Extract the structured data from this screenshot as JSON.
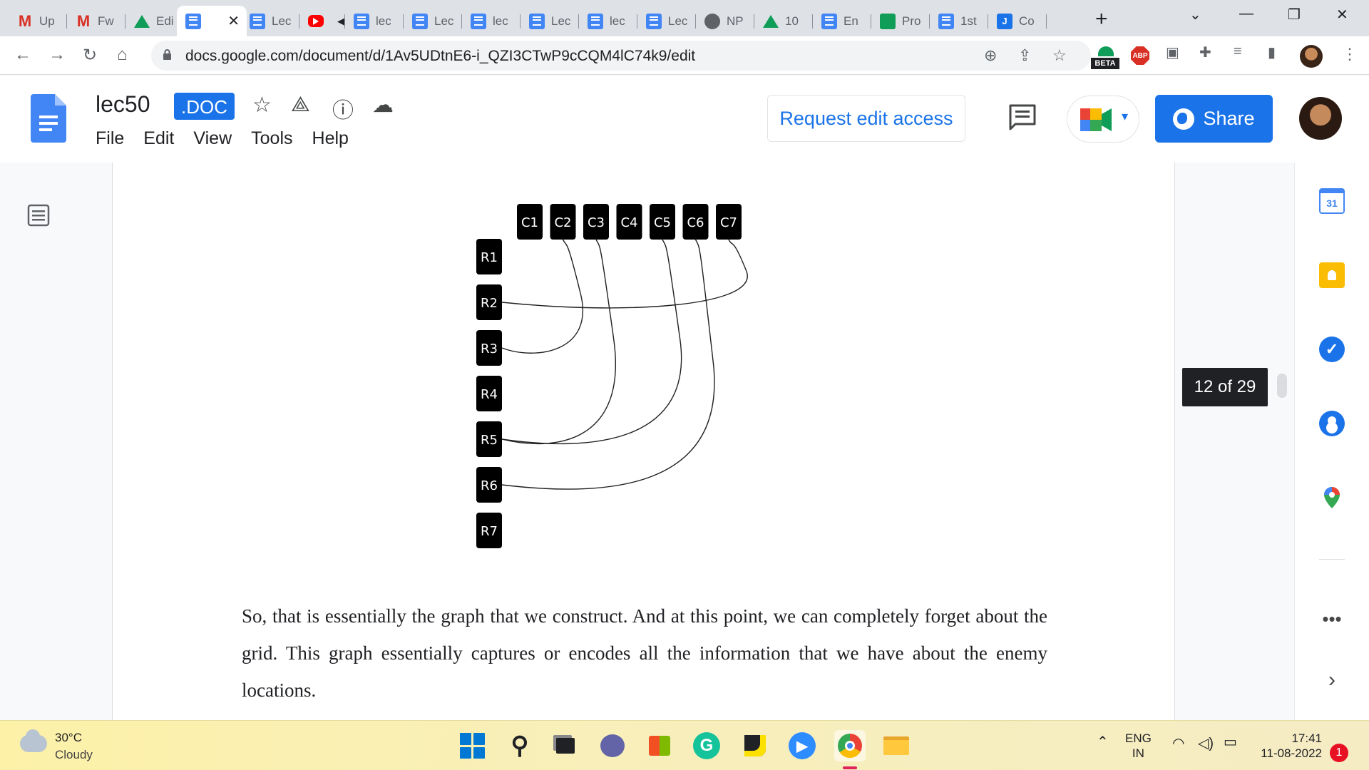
{
  "browser": {
    "tabs": [
      {
        "icon": "gmail",
        "label": "Up"
      },
      {
        "icon": "gmail",
        "label": "Fw"
      },
      {
        "icon": "drive",
        "label": "Edi"
      },
      {
        "icon": "docs",
        "label": "",
        "active": true
      },
      {
        "icon": "docs",
        "label": "Lec"
      },
      {
        "icon": "youtube",
        "label": ""
      },
      {
        "icon": "docs",
        "label": "lec"
      },
      {
        "icon": "docs",
        "label": "Lec"
      },
      {
        "icon": "docs",
        "label": "lec"
      },
      {
        "icon": "docs",
        "label": "Lec"
      },
      {
        "icon": "docs",
        "label": "lec"
      },
      {
        "icon": "docs",
        "label": "Lec"
      },
      {
        "icon": "globe",
        "label": "NP"
      },
      {
        "icon": "drive",
        "label": "10"
      },
      {
        "icon": "docs",
        "label": "En"
      },
      {
        "icon": "sheets",
        "label": "Pro"
      },
      {
        "icon": "docs",
        "label": "1st"
      },
      {
        "icon": "jamboard",
        "label": "Co"
      }
    ],
    "url": "docs.google.com/document/d/1Av5UDtnE6-i_QZI3CTwP9cCQM4lC74k9/edit",
    "extensions": {
      "beta_label": "BETA",
      "abp_label": "ABP"
    }
  },
  "docs": {
    "title": "lec50",
    "badge": ".DOC",
    "menu": [
      "File",
      "Edit",
      "View",
      "Tools",
      "Help"
    ],
    "request_access_label": "Request edit access",
    "share_label": "Share",
    "page_counter": "12 of 29"
  },
  "document": {
    "graph": {
      "columns": [
        "C1",
        "C2",
        "C3",
        "C4",
        "C5",
        "C6",
        "C7"
      ],
      "rows": [
        "R1",
        "R2",
        "R3",
        "R4",
        "R5",
        "R6",
        "R7"
      ],
      "edges": [
        [
          "R2",
          "C7"
        ],
        [
          "R3",
          "C2"
        ],
        [
          "R5",
          "C3"
        ],
        [
          "R5",
          "C5"
        ],
        [
          "R6",
          "C6"
        ]
      ]
    },
    "paragraph": "So, that is essentially the graph that we construct. And at this point, we can completely forget about the grid. This graph essentially captures or encodes all the information that we have about the enemy locations."
  },
  "side_panel": {
    "calendar_day": "31"
  },
  "taskbar": {
    "weather_temp": "30°C",
    "weather_desc": "Cloudy",
    "lang_top": "ENG",
    "lang_bottom": "IN",
    "time": "17:41",
    "date": "11-08-2022",
    "notifications": "1"
  },
  "colors": {
    "accent": "#1a73e8",
    "page": "#ffffff",
    "canvas": "#f8f9fa",
    "node": "#000000"
  }
}
